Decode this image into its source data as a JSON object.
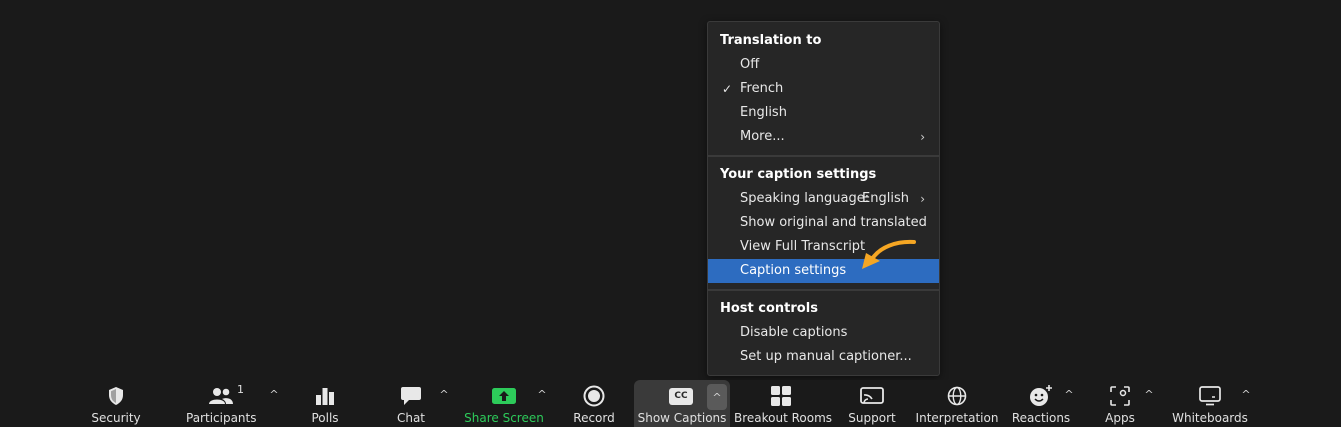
{
  "menu": {
    "translation": {
      "heading": "Translation to",
      "items": [
        {
          "label": "Off",
          "checked": false
        },
        {
          "label": "French",
          "checked": true
        },
        {
          "label": "English",
          "checked": false
        },
        {
          "label": "More...",
          "checked": false
        }
      ]
    },
    "caption_settings": {
      "heading": "Your caption settings",
      "speaking_language_label": "Speaking language:",
      "speaking_language_value": "English",
      "show_original_label": "Show original and translated",
      "view_transcript_label": "View Full Transcript",
      "caption_settings_label": "Caption settings"
    },
    "host_controls": {
      "heading": "Host controls",
      "disable_captions_label": "Disable captions",
      "setup_captioner_label": "Set up manual captioner..."
    },
    "check_glyph": "✓",
    "chevron_glyph": "›"
  },
  "toolbar": {
    "security": "Security",
    "participants": "Participants",
    "participants_count": "1",
    "polls": "Polls",
    "chat": "Chat",
    "share_screen": "Share Screen",
    "record": "Record",
    "show_captions": "Show Captions",
    "captions_icon_text": "CC",
    "breakout_rooms": "Breakout Rooms",
    "support": "Support",
    "interpretation": "Interpretation",
    "reactions": "Reactions",
    "apps": "Apps",
    "whiteboards": "Whiteboards",
    "caret_glyph": "^"
  },
  "colors": {
    "highlight": "#2d6cc0",
    "share_green": "#2dcb5a",
    "arrow_orange": "#f5a623"
  }
}
